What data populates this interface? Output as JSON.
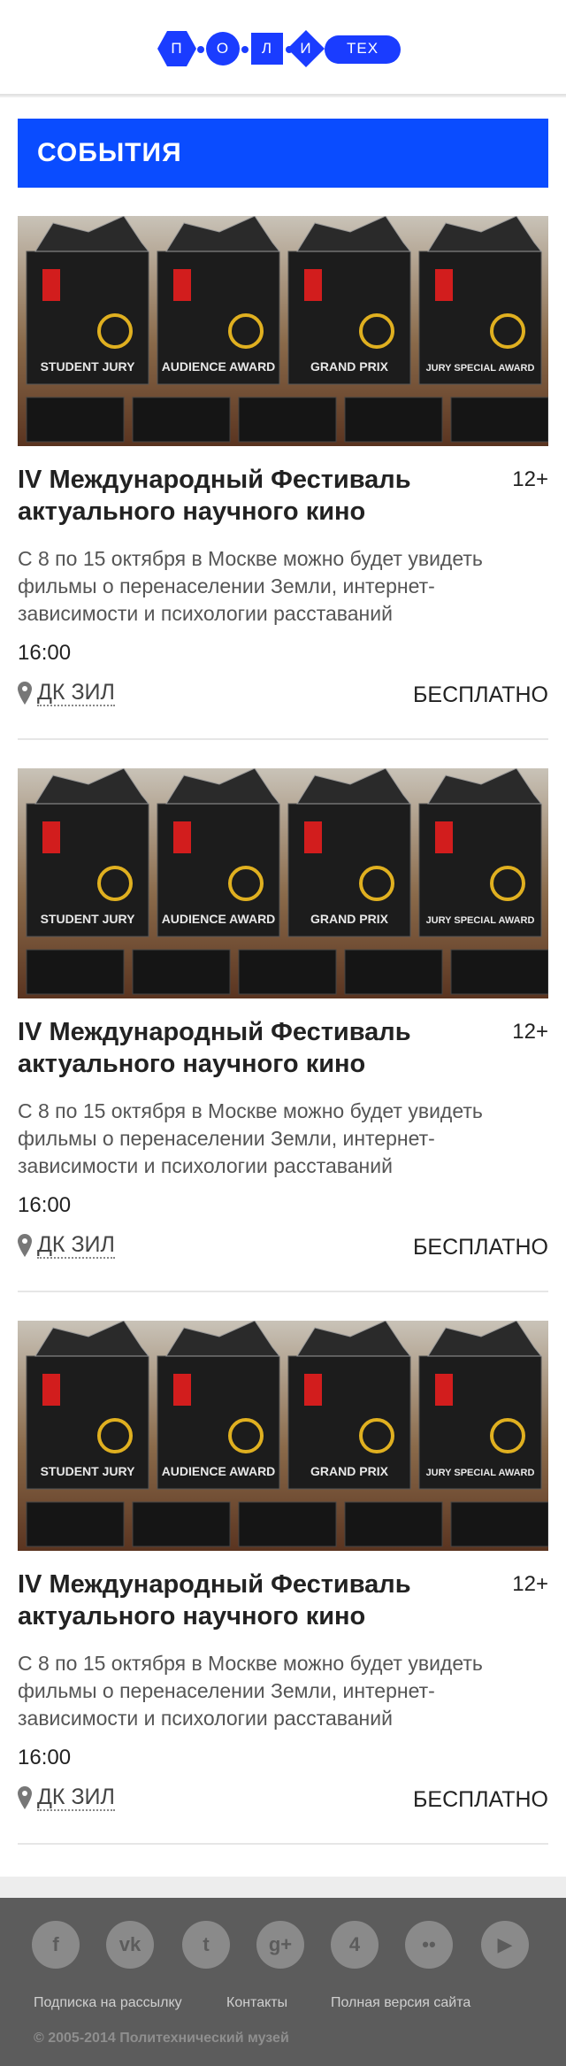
{
  "header": {
    "logo_letters": [
      "П",
      "О",
      "Л",
      "И",
      "ТЕХ"
    ]
  },
  "section": {
    "title": "СОБЫТИЯ"
  },
  "events": [
    {
      "title": "IV Международный Фестиваль актуального научного кино",
      "age": "12+",
      "description": "С 8 по 15 октября в Москве можно будет увидеть фильмы о перенаселении Земли, интернет-зависимости и психологии расставаний",
      "time": "16:00",
      "place": "ДК ЗИЛ",
      "price": "БЕСПЛАТНО",
      "award_labels": [
        "STUDENT JURY",
        "AUDIENCE AWARD",
        "GRAND PRIX",
        "JURY SPECIAL AWARD"
      ]
    },
    {
      "title": "IV Международный Фестиваль актуального научного кино",
      "age": "12+",
      "description": "С 8 по 15 октября в Москве можно будет увидеть фильмы о перенаселении Земли, интернет-зависимости и психологии расставаний",
      "time": "16:00",
      "place": "ДК ЗИЛ",
      "price": "БЕСПЛАТНО",
      "award_labels": [
        "STUDENT JURY",
        "AUDIENCE AWARD",
        "GRAND PRIX",
        "JURY SPECIAL AWARD"
      ]
    },
    {
      "title": "IV Международный Фестиваль актуального научного кино",
      "age": "12+",
      "description": "С 8 по 15 октября в Москве можно будет увидеть фильмы о перенаселении Земли, интернет-зависимости и психологии расставаний",
      "time": "16:00",
      "place": "ДК ЗИЛ",
      "price": "БЕСПЛАТНО",
      "award_labels": [
        "STUDENT JURY",
        "AUDIENCE AWARD",
        "GRAND PRIX",
        "JURY SPECIAL AWARD"
      ]
    }
  ],
  "footer": {
    "social": [
      {
        "icon": "facebook-icon",
        "glyph": "f"
      },
      {
        "icon": "vk-icon",
        "glyph": "vk"
      },
      {
        "icon": "twitter-icon",
        "glyph": "t"
      },
      {
        "icon": "google-plus-icon",
        "glyph": "g+"
      },
      {
        "icon": "foursquare-icon",
        "glyph": "4"
      },
      {
        "icon": "flickr-icon",
        "glyph": "••"
      },
      {
        "icon": "youtube-icon",
        "glyph": "▶"
      }
    ],
    "links": [
      "Подписка на рассылку",
      "Контакты",
      "Полная версия сайта"
    ],
    "copyright": "© 2005-2014 Политехнический музей"
  },
  "colors": {
    "brand_blue": "#0a4cff",
    "footer_bg": "#5c5c5c"
  }
}
